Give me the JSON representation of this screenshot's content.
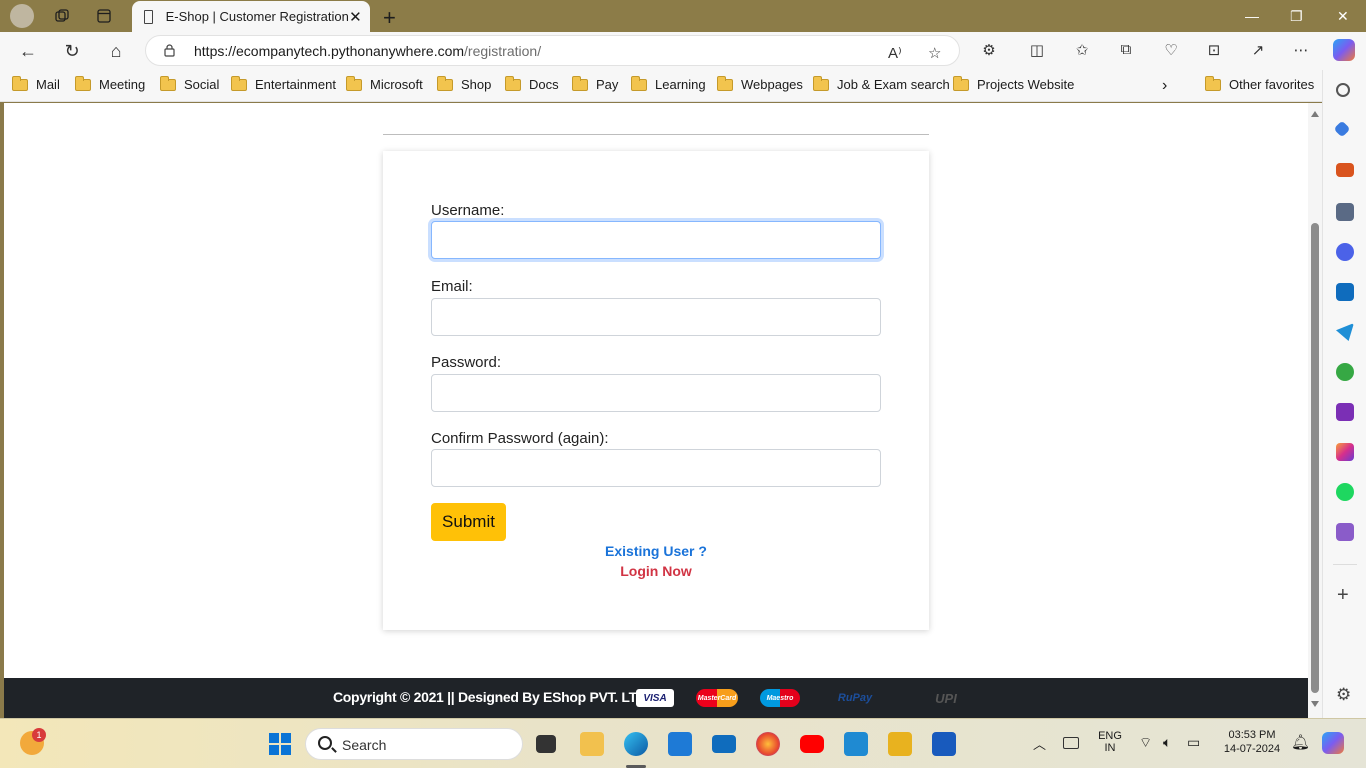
{
  "browser": {
    "tab_title": "E-Shop | Customer Registration",
    "url_host": "https://ecompanytech.pythonanywhere.com",
    "url_path": "/registration/"
  },
  "favorites": [
    "Mail",
    "Meeting",
    "Social",
    "Entertainment",
    "Microsoft",
    "Shop",
    "Docs",
    "Pay",
    "Learning",
    "Webpages",
    "Job & Exam search",
    "Projects Website"
  ],
  "other_favorites": "Other favorites",
  "form": {
    "username_label": "Username:",
    "email_label": "Email:",
    "password_label": "Password:",
    "confirm_label": "Confirm Password (again):",
    "submit_label": "Submit",
    "existing_user": "Existing User ?",
    "login_now": "Login Now"
  },
  "footer": {
    "copyright": "Copyright © 2021 || Designed By EShop PVT. LTD.||",
    "payment_logos": [
      "VISA",
      "MasterCard",
      "Maestro",
      "RuPay",
      "UPI"
    ]
  },
  "taskbar": {
    "search_label": "Search",
    "language": "ENG",
    "region": "IN",
    "time": "03:53 PM",
    "date": "14-07-2024",
    "notification_count": "1"
  },
  "colors": {
    "submit": "#ffc107",
    "existing": "#1a73d9",
    "login": "#d13444",
    "footer_bg": "#1f2328"
  }
}
